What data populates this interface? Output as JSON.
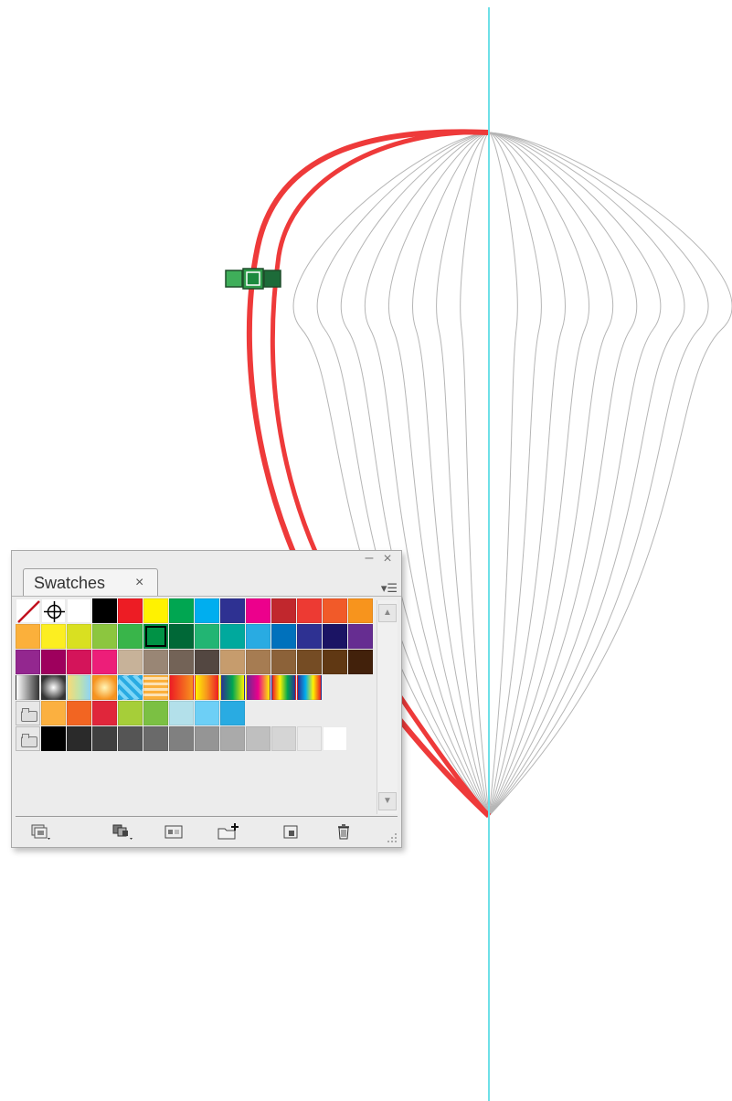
{
  "panel": {
    "title": "Swatches",
    "tab_close_glyph": "×",
    "collapse_glyph": "–",
    "close_glyph": "×",
    "menu_glyph": "▾☰",
    "scroll_up_glyph": "▲",
    "scroll_down_glyph": "▼"
  },
  "swatch_rows": [
    [
      "none",
      "registration",
      "#ffffff",
      "#000000",
      "#ed1c24",
      "#fff200",
      "#00a651",
      "#00aeef",
      "#2e3192",
      "#ec008c",
      "#c1272d",
      "#ed3a33",
      "#f15a29",
      "#f7941d"
    ],
    [
      "#fbb03b",
      "#fcee21",
      "#d9e021",
      "#8cc63f",
      "#39b54a",
      "#009245",
      "#006837",
      "#22b573",
      "#00a99d",
      "#29abe2",
      "#0071bc",
      "#2e3192",
      "#1b1464",
      "#662d91"
    ],
    [
      "#93278f",
      "#9e005d",
      "#d4145a",
      "#ed1e79",
      "#c7b299",
      "#998675",
      "#736357",
      "#534741",
      "#c69c6d",
      "#a67c52",
      "#8c6239",
      "#754c24",
      "#603813",
      "#42210b"
    ],
    [
      "gradient-gray",
      "gradient-radial",
      "gradient-rainbow-soft",
      "gradient-orange-radial",
      "pattern-blue",
      "pattern-orange",
      "gradient-red-orange",
      "gradient-spectrum",
      "gradient-blue-green",
      "gradient-purple",
      "gradient-rainbow",
      "gradient-spectrum-2"
    ],
    [
      "folder",
      "#fbb040",
      "#f26522",
      "#e0263b",
      "#a6ce39",
      "#7bc043",
      "#b3e0ea",
      "#6dcff6",
      "#29abe2"
    ],
    [
      "folder",
      "#000000",
      "#2a2a2a",
      "#404040",
      "#555555",
      "#6a6a6a",
      "#808080",
      "#959595",
      "#aaaaaa",
      "#bfbfbf",
      "#d5d5d5",
      "#eaeaea",
      "#ffffff"
    ]
  ],
  "selected_swatch": "#009245",
  "accent_colors": {
    "guide": "#6ee0e8",
    "outline_stroke": "#ee3a3a",
    "gore_lines": "#b5b5b5",
    "anchor_handle": "#2e9b4a"
  },
  "bottom_tools": [
    {
      "name": "swatch-libraries-menu-icon"
    },
    {
      "name": "show-swatch-kinds-menu-icon"
    },
    {
      "name": "swatch-options-icon"
    },
    {
      "name": "new-color-group-icon"
    },
    {
      "name": "new-swatch-icon"
    },
    {
      "name": "delete-swatch-icon"
    }
  ]
}
